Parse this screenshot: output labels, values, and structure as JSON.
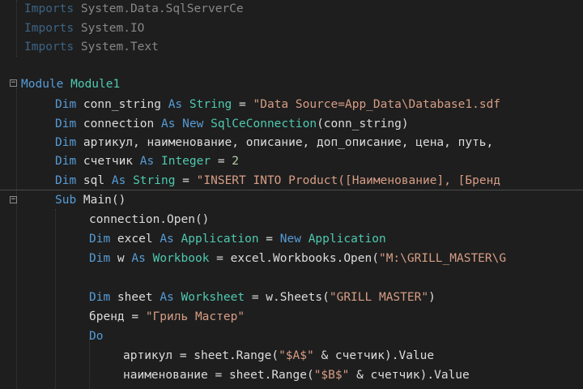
{
  "colors": {
    "background": "#1e1e1e",
    "keyword": "#569cd6",
    "type": "#4ec9b0",
    "string": "#d69d85",
    "number": "#b5cea8",
    "text": "#dcdcdc"
  },
  "lines": {
    "l1": {
      "kw": "Imports",
      "rest": " System.Data.SqlServerCe"
    },
    "l2": {
      "kw": "Imports",
      "rest": " System.IO"
    },
    "l3": {
      "kw": "Imports",
      "rest": " System.Text"
    },
    "l5": {
      "kw": "Module",
      "name": " Module1"
    },
    "l6": {
      "kw1": "Dim",
      "a": " conn_string ",
      "kw2": "As",
      "sp": " ",
      "ty": "String",
      "b": " = ",
      "str": "\"Data Source=App_Data\\Database1.sdf"
    },
    "l7": {
      "kw1": "Dim",
      "a": " connection ",
      "kw2": "As",
      "sp": " ",
      "kw3": "New",
      "sp2": " ",
      "ty": "SqlCeConnection",
      "b": "(conn_string)"
    },
    "l8": {
      "kw1": "Dim",
      "a": " артикул, наименование, описание, доп_описание, цена, путь,"
    },
    "l9": {
      "kw1": "Dim",
      "a": " счетчик ",
      "kw2": "As",
      "sp": " ",
      "ty": "Integer",
      "b": " = ",
      "num": "2"
    },
    "l10": {
      "kw1": "Dim",
      "a": " sql ",
      "kw2": "As",
      "sp": " ",
      "ty": "String",
      "b": " = ",
      "str": "\"INSERT INTO Product([Наименование], [Бренд"
    },
    "l11": {
      "kw": "Sub",
      "rest": " Main()"
    },
    "l12": {
      "text": "connection.Open()"
    },
    "l13": {
      "kw1": "Dim",
      "a": " excel ",
      "kw2": "As",
      "sp": " ",
      "ty": "Application",
      "b": " = ",
      "kw3": "New",
      "sp2": " ",
      "ty2": "Application"
    },
    "l14": {
      "kw1": "Dim",
      "a": " w ",
      "kw2": "As",
      "sp": " ",
      "ty": "Workbook",
      "b": " = excel.Workbooks.Open(",
      "str": "\"M:\\GRILL_MASTER\\G"
    },
    "l16": {
      "kw1": "Dim",
      "a": " sheet ",
      "kw2": "As",
      "sp": " ",
      "ty": "Worksheet",
      "b": " = w.Sheets(",
      "str": "\"GRILL MASTER\"",
      "c": ")"
    },
    "l17": {
      "a": "бренд = ",
      "str": "\"Гриль Мастер\""
    },
    "l18": {
      "kw": "Do"
    },
    "l19": {
      "a": "артикул = sheet.Range(",
      "str": "\"$A$\"",
      "b": " & счетчик).Value"
    },
    "l20": {
      "a": "наименование = sheet.Range(",
      "str": "\"$B$\"",
      "b": " & счетчик).Value"
    }
  }
}
